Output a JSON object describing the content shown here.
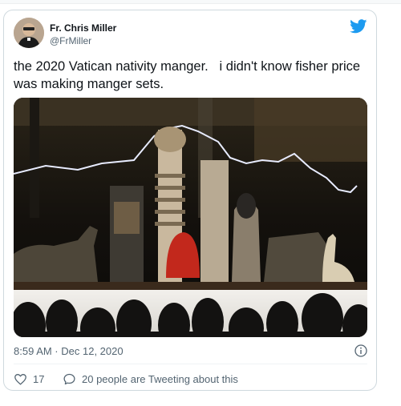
{
  "tweet": {
    "author_name": "Fr. Chris Miller",
    "author_handle": "@FrMiller",
    "text": "the 2020 Vatican nativity manger.   i didn't know fisher price was making manger sets.",
    "timestamp": "8:59 AM · Dec 12, 2020",
    "likes": "17",
    "conversation_text": "20 people are Tweeting about this"
  },
  "icons": {
    "brand": "twitter-bird-icon",
    "info": "info-icon",
    "like": "heart-icon",
    "reply": "speech-bubble-icon"
  },
  "colors": {
    "brand_blue": "#1d9bf0",
    "secondary_text": "#536471",
    "border": "#cfd9de"
  }
}
